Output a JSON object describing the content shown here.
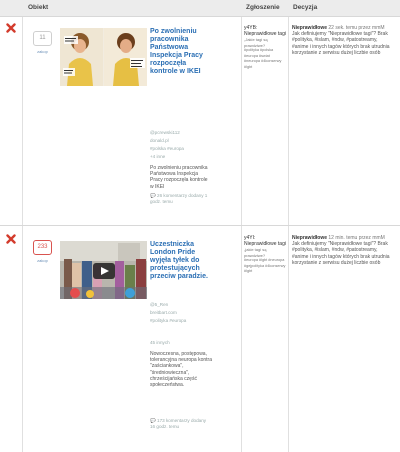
{
  "header": {
    "obiekt": "Obiekt",
    "zgloszenie": "Zgłoszenie",
    "decyzja": "Decyzja"
  },
  "colors": {
    "reject": "#d33b2c",
    "link": "#2b6fb4",
    "hot_count": "#d9534f"
  },
  "rows": [
    {
      "status_icon": "reject-x-icon",
      "vote_count": "11",
      "vote_label": "zakop",
      "title": "Po zwolnieniu pracownika Państwowa Inspekcja Pracy rozpoczęła kontrole w IKEI",
      "author": "@pcrewski112",
      "source": "donald.pl",
      "tag": "#polska",
      "tag2": "#europa",
      "extra": "+4 inne",
      "desc": "Po zwolnieniu pracownika Państwowa Inspekcja Pracy rozpoczęła kontrole w IKEI",
      "comments": "26 komentarzy dodany 1 godz. temu",
      "report_main": "y4YB: Nieprawidłowe tagi",
      "report_quote": "„Jakie tagi są prawdziwe?",
      "report_tags": "#polityka #polska #europa #swiat #neuropa #4konserwy #lgbt",
      "decision_status": "Nieprawidłowe",
      "decision_time": "22 sek. temu przez mmM",
      "decision_text": "Jak definiujemy \"Nieprawidłowe tagi\"? Brak #polityka, #islam, #ndw, #patostreamy, #anime i innych tagów których brak utrudnia korzystanie z serwisu dużej liczbie osób"
    },
    {
      "status_icon": "reject-x-icon",
      "vote_count": "233",
      "vote_label": "zakop",
      "title": "Uczestniczka London Pride wyjęła tyłek do protestujących przeciw paradzie.",
      "author": "@5_Ren",
      "source": "breitbart.com",
      "tag": "#polityka",
      "tag2": "#europa",
      "extra": "45 innych",
      "desc": "Nowoczesna, postępowa, tolerancyjna neuropa kontra \"zaściankowa\", \"średniowieczna\", chrześcijańska część społeczeństwa.",
      "comments": "173 komentarzy dodany 16 godz. temu",
      "report_main": "y4YI: Nieprawidłowe tagi",
      "report_quote": "„jakie tagi są prawdziwe?",
      "report_tags": "#europa #lgbt #neuropa #gejpolityka #4konserwy #lgbt",
      "decision_status": "Nieprawidłowe",
      "decision_time": "12 min. temu przez mmM",
      "decision_text": "Jak definiujemy \"Nieprawidłowe tagi\"? Brak #polityka, #islam, #ndw, #patostreamy, #anime i innych tagów których brak utrudnia korzystanie z serwisu dużej liczbie osób"
    }
  ]
}
